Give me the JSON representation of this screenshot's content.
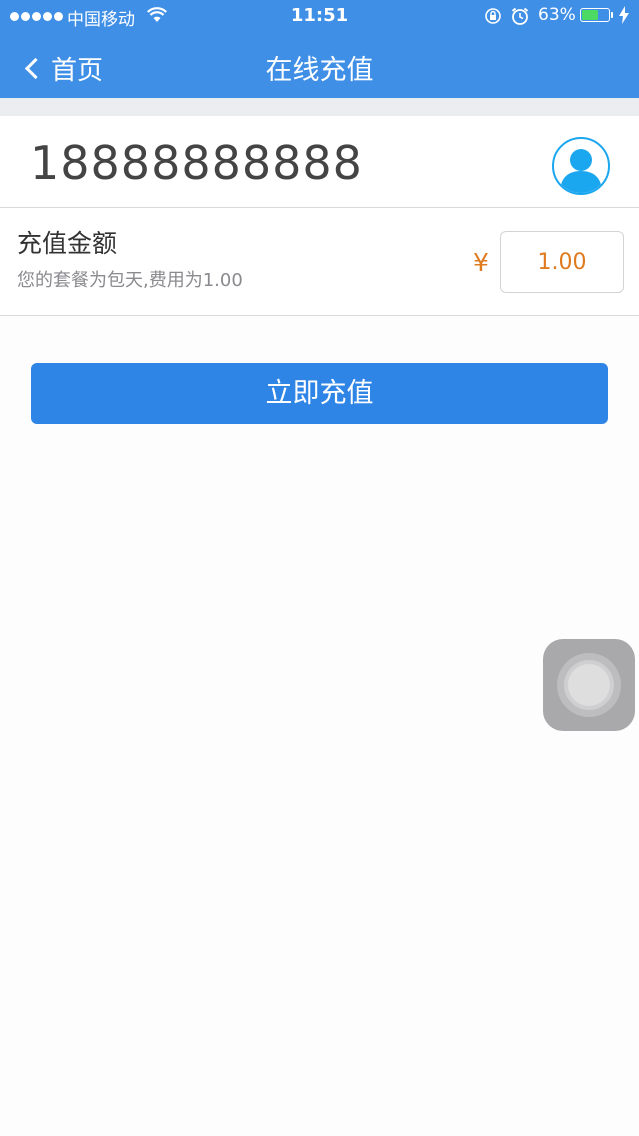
{
  "status_bar": {
    "carrier": "中国移动",
    "time": "11:51",
    "battery_percent": "63%",
    "battery_level": 0.63,
    "battery_color": "#4cd964"
  },
  "nav": {
    "back_label": "首页",
    "title": "在线充值",
    "background": "#3f8fe7"
  },
  "phone": {
    "number": "18888888888",
    "contact_icon": "person-icon",
    "icon_color": "#1aa7f0"
  },
  "amount": {
    "label": "充值金额",
    "description": "您的套餐为包天,费用为1.00",
    "currency_symbol": "¥",
    "value": "1.00",
    "accent_color": "#e07a1f"
  },
  "actions": {
    "recharge_label": "立即充值",
    "button_color": "#2f85e6"
  }
}
